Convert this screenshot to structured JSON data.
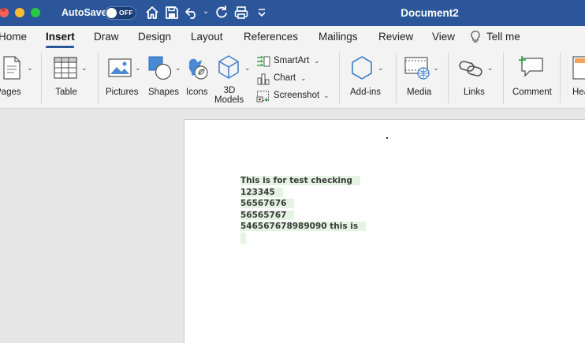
{
  "window": {
    "autosave_label": "AutoSave",
    "autosave_state": "OFF",
    "document_title": "Document2"
  },
  "menu": {
    "tabs": [
      "Home",
      "Insert",
      "Draw",
      "Design",
      "Layout",
      "References",
      "Mailings",
      "Review",
      "View",
      "Tell me"
    ],
    "active_tab": "Insert"
  },
  "ribbon": {
    "pages": "Pages",
    "table": "Table",
    "pictures": "Pictures",
    "shapes": "Shapes",
    "icons": "Icons",
    "models_line1": "3D",
    "models_line2": "Models",
    "smartart": "SmartArt",
    "chart": "Chart",
    "screenshot": "Screenshot",
    "addins": "Add-ins",
    "media": "Media",
    "links": "Links",
    "comment": "Comment",
    "header_partial": "Hea"
  },
  "document": {
    "lines": [
      "This is for test checking",
      "123345",
      "56567676",
      "56565767",
      "546567678989090 this is"
    ]
  },
  "colors": {
    "titlebar": "#2b579a",
    "highlight": "#e5f3e3",
    "accent_green": "#3aa54a"
  }
}
